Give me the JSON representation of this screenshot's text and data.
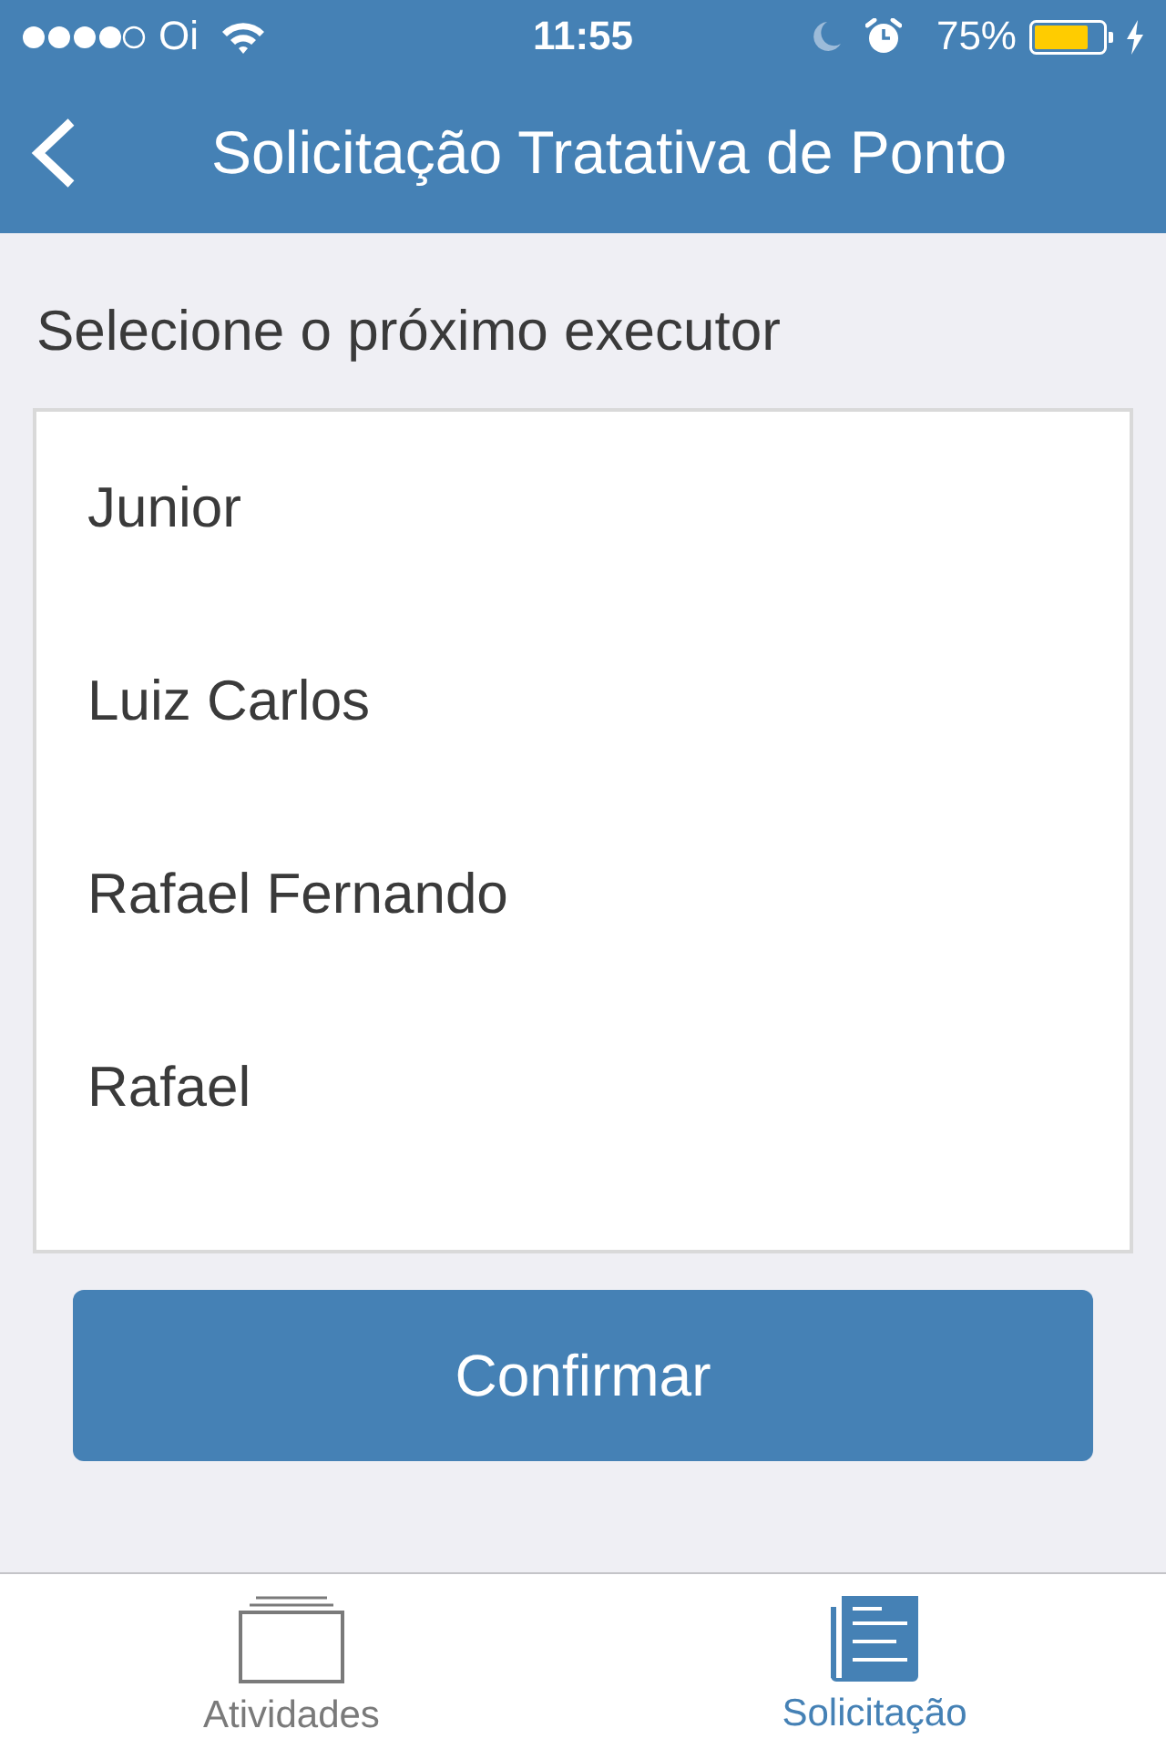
{
  "status_bar": {
    "carrier": "Oi",
    "time": "11:55",
    "battery": "75%"
  },
  "nav_bar": {
    "title": "Solicitação Tratativa de Ponto"
  },
  "prompt": "Selecione o próximo executor",
  "executors": [
    {
      "name": "Junior",
      "selected": false
    },
    {
      "name": "Luiz Carlos",
      "selected": false
    },
    {
      "name": "Rafael Fernando",
      "selected": false
    },
    {
      "name": "Rafael",
      "selected": false
    }
  ],
  "confirm_button": "Confirmar",
  "tabs": [
    {
      "label": "Atividades",
      "selected": false
    },
    {
      "label": "Solicitação",
      "selected": true
    }
  ]
}
